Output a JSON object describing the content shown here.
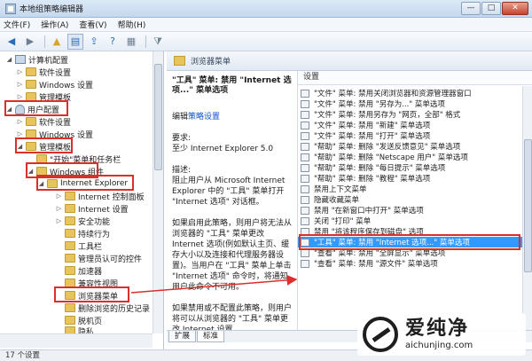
{
  "window": {
    "title": "本地组策略编辑器",
    "controls": {
      "minimize": "—",
      "maximize": "□",
      "close": "✕"
    }
  },
  "menubar": {
    "items": [
      "文件(F)",
      "操作(A)",
      "查看(V)",
      "帮助(H)"
    ]
  },
  "toolbar": {
    "back": "◀",
    "forward": "▶",
    "up": "▲",
    "list": "▤",
    "export": "⇪",
    "help": "?",
    "properties": "▦",
    "filter": "⧩"
  },
  "tree": {
    "items": [
      {
        "label": "计算机配置",
        "expander": "◢"
      },
      {
        "label": "软件设置",
        "expander": "▷"
      },
      {
        "label": "Windows 设置",
        "expander": "▷"
      },
      {
        "label": "管理模板",
        "expander": "▷"
      },
      {
        "label": "用户配置",
        "expander": "◢"
      },
      {
        "label": "软件设置",
        "expander": "▷"
      },
      {
        "label": "Windows 设置",
        "expander": "▷"
      },
      {
        "label": "管理模板",
        "expander": "◢"
      },
      {
        "label": "\"开始\"菜单和任务栏",
        "expander": ""
      },
      {
        "label": "Windows 组件",
        "expander": "◢"
      },
      {
        "label": "Internet Explorer",
        "expander": "◢"
      },
      {
        "label": "Internet 控制面板",
        "expander": "▷"
      },
      {
        "label": "Internet 设置",
        "expander": "▷"
      },
      {
        "label": "安全功能",
        "expander": "▷"
      },
      {
        "label": "持续行为",
        "expander": ""
      },
      {
        "label": "工具栏",
        "expander": ""
      },
      {
        "label": "管理员认可的控件",
        "expander": ""
      },
      {
        "label": "加速器",
        "expander": ""
      },
      {
        "label": "兼容性视图",
        "expander": ""
      },
      {
        "label": "浏览器菜单",
        "expander": ""
      },
      {
        "label": "删除浏览的历史记录",
        "expander": ""
      },
      {
        "label": "脱机页",
        "expander": ""
      },
      {
        "label": "隐私",
        "expander": ""
      }
    ]
  },
  "header": {
    "title": "浏览器菜单"
  },
  "description": {
    "title": "\"工具\" 菜单: 禁用 \"Internet 选项...\" 菜单选项",
    "edit_prefix": "编辑",
    "edit_link": "策略设置",
    "requirement_label": "要求:",
    "requirement_text": "至少 Internet Explorer 5.0",
    "desc_label": "描述:",
    "desc_text": "阻止用户从 Microsoft Internet Explorer 中的 \"工具\" 菜单打开 \"Internet 选项\" 对话框。",
    "enabled_text": "如果启用此策略，则用户将无法从浏览器的 \"工具\" 菜单更改 Internet 选项(例如默认主页、缓存大小以及连接和代理服务器设置)。当用户在 \"工具\" 菜单上单击 \"Internet 选项\" 命令时，将通知用户此命令不可用。",
    "disabled_text": "如果禁用或不配置此策略，则用户将可以从浏览器的 \"工具\" 菜单更改 Internet 设置。"
  },
  "list": {
    "header": "设置",
    "rows": [
      "\"文件\" 菜单: 禁用关闭浏览器和资源管理器窗口",
      "\"文件\" 菜单: 禁用 \"另存为...\" 菜单选项",
      "\"文件\" 菜单: 禁用另存为 \"网页，全部\" 格式",
      "\"文件\" 菜单: 禁用 \"新建\" 菜单选项",
      "\"文件\" 菜单: 禁用 \"打开\" 菜单选项",
      "\"帮助\" 菜单: 删除 \"发送反馈意见\" 菜单选项",
      "\"帮助\" 菜单: 删除 \"Netscape 用户\" 菜单选项",
      "\"帮助\" 菜单: 删除 \"每日提示\" 菜单选项",
      "\"帮助\" 菜单: 删除 \"教程\" 菜单选项",
      "禁用上下文菜单",
      "隐藏收藏菜单",
      "禁用 \"在新窗口中打开\" 菜单选项",
      "关闭 \"打印\" 菜单",
      "禁用 \"将该程序保存到磁盘\" 选项",
      "\"工具\" 菜单: 禁用 \"Internet 选项...\" 菜单选项",
      "\"查看\" 菜单: 禁用 \"全屏显示\" 菜单选项",
      "\"查看\" 菜单: 禁用 \"源文件\" 菜单选项"
    ],
    "selected_index": 14
  },
  "view_tabs": [
    "扩展",
    "标准"
  ],
  "status": {
    "text": "17 个设置"
  },
  "watermark": {
    "brand": "爱纯净",
    "url": "aichunjing.com"
  },
  "colors": {
    "highlight": "#d9302c",
    "selection": "#3399ff",
    "link": "#1155cc"
  }
}
